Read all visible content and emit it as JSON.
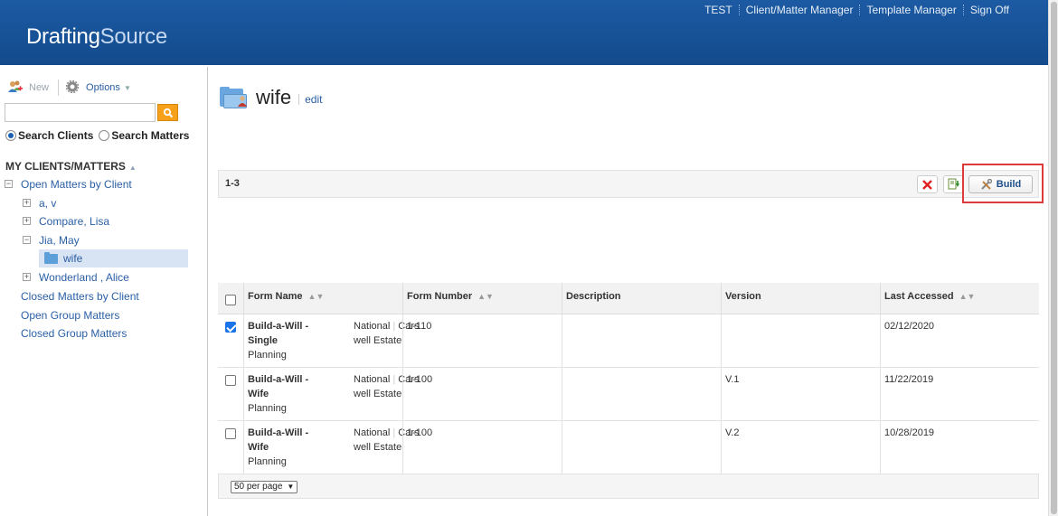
{
  "header": {
    "logo_a": "Drafting",
    "logo_b": "Source",
    "nav": [
      "TEST",
      "Client/Matter Manager",
      "Template Manager",
      "Sign Off"
    ]
  },
  "sidebar": {
    "new_label": "New",
    "options_label": "Options",
    "search_value": "",
    "radio_clients": "Search Clients",
    "radio_matters": "Search Matters",
    "section_title": "MY CLIENTS/MATTERS",
    "tree": {
      "open_by_client": "Open Matters by Client",
      "clients": [
        "a, v",
        "Compare, Lisa",
        "Jia, May",
        "Wonderland , Alice"
      ],
      "selected_matter": "wife",
      "closed_by_client": "Closed Matters by Client",
      "open_group": "Open Group Matters",
      "closed_group": "Closed Group Matters"
    }
  },
  "main": {
    "title": "wife",
    "edit_label": "edit",
    "count": "1-3",
    "build_label": "Build",
    "columns": [
      "Form Name",
      "Form Number",
      "Description",
      "Version",
      "Last Accessed"
    ],
    "rows": [
      {
        "name1": "Build-a-Will -",
        "name2": "Single",
        "category": "Planning",
        "pub1": "National",
        "pub1b": "Cars",
        "pub2": "well Estate",
        "number": "1-110",
        "description": "",
        "version": "",
        "accessed": "02/12/2020",
        "checked": true
      },
      {
        "name1": "Build-a-Will -",
        "name2": "Wife",
        "category": "Planning",
        "pub1": "National",
        "pub1b": "Cars",
        "pub2": "well Estate",
        "number": "1-100",
        "description": "",
        "version": "V.1",
        "accessed": "11/22/2019",
        "checked": false
      },
      {
        "name1": "Build-a-Will -",
        "name2": "Wife",
        "category": "Planning",
        "pub1": "National",
        "pub1b": "Cars",
        "pub2": "well Estate",
        "number": "1-100",
        "description": "",
        "version": "V.2",
        "accessed": "10/28/2019",
        "checked": false
      }
    ],
    "per_page": "50 per page"
  },
  "colors": {
    "header": "#1c5aa3",
    "link": "#2a5fa6",
    "search_btn": "#f7a11b",
    "highlight": "#dd3b3b"
  }
}
